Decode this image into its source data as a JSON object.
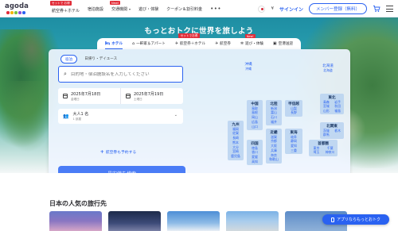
{
  "header": {
    "logo_text": "agoda",
    "logo_dot_colors": [
      "#e12d39",
      "#f7b500",
      "#7ac143",
      "#8a4fd8",
      "#2a62f1"
    ],
    "nav": [
      {
        "label": "航空券＋ホテル",
        "badge": "セットで お得"
      },
      {
        "label": "宿泊施設",
        "badge": ""
      },
      {
        "label": "交通機関",
        "badge": "New!",
        "caret": true
      },
      {
        "label": "遊び・体験",
        "badge": ""
      },
      {
        "label": "クーポン＆割引料金",
        "badge": ""
      }
    ],
    "more": "•••",
    "currency": "¥",
    "signin": "サインイン",
    "member_button": "メンバー登録（無料）"
  },
  "hero": {
    "title": "もっとおトクに世界を旅しよう",
    "tabs": [
      {
        "label": "ホテル",
        "icon": "bed-icon",
        "active": true,
        "badge": ""
      },
      {
        "label": "一軒家＆アパート",
        "icon": "house-icon",
        "active": false,
        "badge": ""
      },
      {
        "label": "航空券＋ホテル",
        "icon": "plane-icon",
        "active": false,
        "badge": "セットでお得"
      },
      {
        "label": "航空券",
        "icon": "plane-icon",
        "active": false,
        "badge": ""
      },
      {
        "label": "遊び・体験",
        "icon": "ferris-wheel-icon",
        "active": false,
        "badge": "New!"
      },
      {
        "label": "空港送迎",
        "icon": "car-icon",
        "active": false,
        "badge": ""
      }
    ]
  },
  "search": {
    "stay_types": [
      "宿泊",
      "日帰り・デイユース"
    ],
    "destination_placeholder": "目的地・宿泊施設名を入力してください",
    "checkin": {
      "date": "2025年7月18日",
      "weekday": "金曜日"
    },
    "checkout": {
      "date": "2025年7月19日",
      "weekday": "土曜日"
    },
    "guests": {
      "main": "大人1 名",
      "sub": "1 部屋"
    },
    "add_flight": "航空券も予約する",
    "search_button": "最安値を検索"
  },
  "map": {
    "okinawa": {
      "head": "沖縄",
      "prefs": [
        "沖縄"
      ]
    },
    "hokkaido": {
      "head": "北海道",
      "prefs": [
        "北海道"
      ]
    },
    "chugoku": {
      "head": "中国",
      "prefs": [
        "鳥取",
        "島根",
        "岡山",
        "広島",
        "山口"
      ]
    },
    "hokuriku": {
      "head": "北陸",
      "prefs": [
        "新潟",
        "富山",
        "石川",
        "福井"
      ]
    },
    "koshinetsu": {
      "head": "甲信越",
      "prefs": [
        "山梨",
        "長野"
      ]
    },
    "tohoku": {
      "head": "東北",
      "prefs": [
        "青森",
        "岩手",
        "宮城",
        "秋田",
        "山形",
        "福島"
      ]
    },
    "kyushu": {
      "head": "九州",
      "prefs": [
        "福岡",
        "佐賀",
        "長崎",
        "熊本",
        "大分",
        "宮崎",
        "鹿児島"
      ]
    },
    "shikoku": {
      "head": "四国",
      "prefs": [
        "徳島",
        "香川",
        "愛媛",
        "高知"
      ]
    },
    "kinki": {
      "head": "近畿",
      "prefs": [
        "滋賀",
        "京都",
        "大阪",
        "兵庫",
        "奈良",
        "和歌山"
      ]
    },
    "tokai": {
      "head": "東海",
      "prefs": [
        "岐阜",
        "静岡",
        "愛知",
        "三重"
      ]
    },
    "kitakanto": {
      "head": "北関東",
      "prefs": [
        "茨城",
        "栃木",
        "群馬"
      ]
    },
    "shutoken": {
      "head": "首都圏",
      "prefs": [
        "東京",
        "千葉",
        "埼玉",
        "神奈川"
      ]
    }
  },
  "section_title": "日本の人気の旅行先",
  "app_promo": "アプリならもっとおトク"
}
